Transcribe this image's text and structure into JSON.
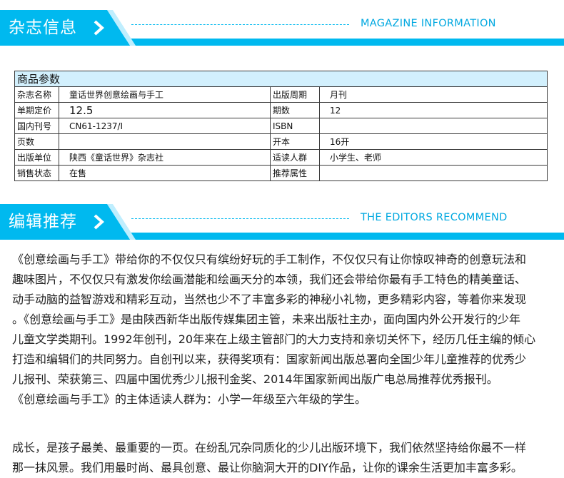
{
  "magazine_section": {
    "title": "杂志信息",
    "english_title": "MAGAZINE INFORMATION"
  },
  "product_params": {
    "caption": "商品参数",
    "rows": [
      {
        "label1": "杂志名称",
        "value1": "童话世界创意绘画与手工",
        "label2": "出版周期",
        "value2": "月刊"
      },
      {
        "label1": "单期定价",
        "value1": "12.5",
        "label2": "期数",
        "value2": "12"
      },
      {
        "label1": "国内刊号",
        "value1": "CN61-1237/I",
        "label2": "ISBN",
        "value2": ""
      },
      {
        "label1": "页数",
        "value1": "",
        "label2": "开本",
        "value2": "16开"
      },
      {
        "label1": "出版单位",
        "value1": "陕西《童话世界》杂志社",
        "label2": "适读人群",
        "value2": "小学生、老师"
      },
      {
        "label1": "销售状态",
        "value1": "在售",
        "label2": "推荐属性",
        "value2": ""
      }
    ]
  },
  "editors_section": {
    "title": "编辑推荐",
    "english_title": "THE EDITORS RECOMMEND"
  },
  "recommend": {
    "lines": [
      "《创意绘画与手工》带给你的不仅仅只有缤纷好玩的手工制作，不仅仅只有让你惊叹神奇的创意玩法和",
      "趣味图片，不仅仅只有激发你绘画潜能和绘画天分的本领，我们还会带给你最有手工特色的精美童话、",
      "动手动脑的益智游戏和精彩互动，当然也少不了丰富多彩的神秘小礼物，更多精彩内容，等着你来发现",
      "。《创意绘画与手工》是由陕西新华出版传媒集团主管，未来出版社主办，面向国内外公开发行的少年",
      "儿童文学类期刊。1992年创刊，20年来在上级主管部门的大力支持和亲切关怀下，经历几任主编的倾心",
      "打造和编辑们的共同努力。自创刊以来，获得奖项有：国家新闻出版总署向全国少年儿童推荐的优秀少",
      "儿报刊、荣获第三、四届中国优秀少儿报刊金奖、2014年国家新闻出版广电总局推荐优秀报刊。",
      "《创意绘画与手工》的主体适读人群为：小学一年级至六年级的学生。"
    ],
    "lines2": [
      "成长，是孩子最美、最重要的一页。在纷乱冗杂同质化的少儿出版环境下，我们依然坚持给你最不一样",
      "那一抹风景。我们用最时尚、最具创意、最让你脑洞大开的DIY作品，让你的课余生活更加丰富多彩。"
    ]
  },
  "colors": {
    "accent": "#00b9ef",
    "table_caption_bg": "#d2f0fd"
  }
}
